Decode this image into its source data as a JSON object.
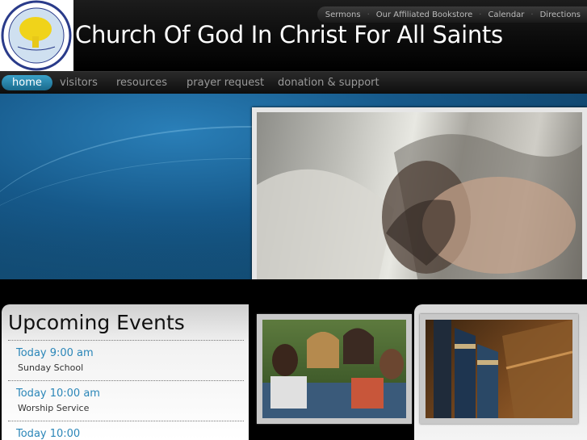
{
  "site": {
    "title": "Church Of God In Christ For All Saints"
  },
  "top_links": [
    "Sermons",
    "Our Affiliated Bookstore",
    "Calendar",
    "Directions"
  ],
  "nav": {
    "items": [
      "home",
      "visitors",
      "resources",
      "prayer request",
      "donation & support"
    ],
    "active": "home"
  },
  "events": {
    "title": "Upcoming Events",
    "items": [
      {
        "time": "Today 9:00 am",
        "name": "Sunday School"
      },
      {
        "time": "Today 10:00 am",
        "name": "Worship Service"
      },
      {
        "time": "Today 10:00",
        "name": ""
      }
    ]
  },
  "colors": {
    "accent": "#2a86b8",
    "nav_active": "#2a8fba",
    "banner": "#1a5f8f"
  },
  "icons": {
    "logo": "church-seal-logo"
  }
}
